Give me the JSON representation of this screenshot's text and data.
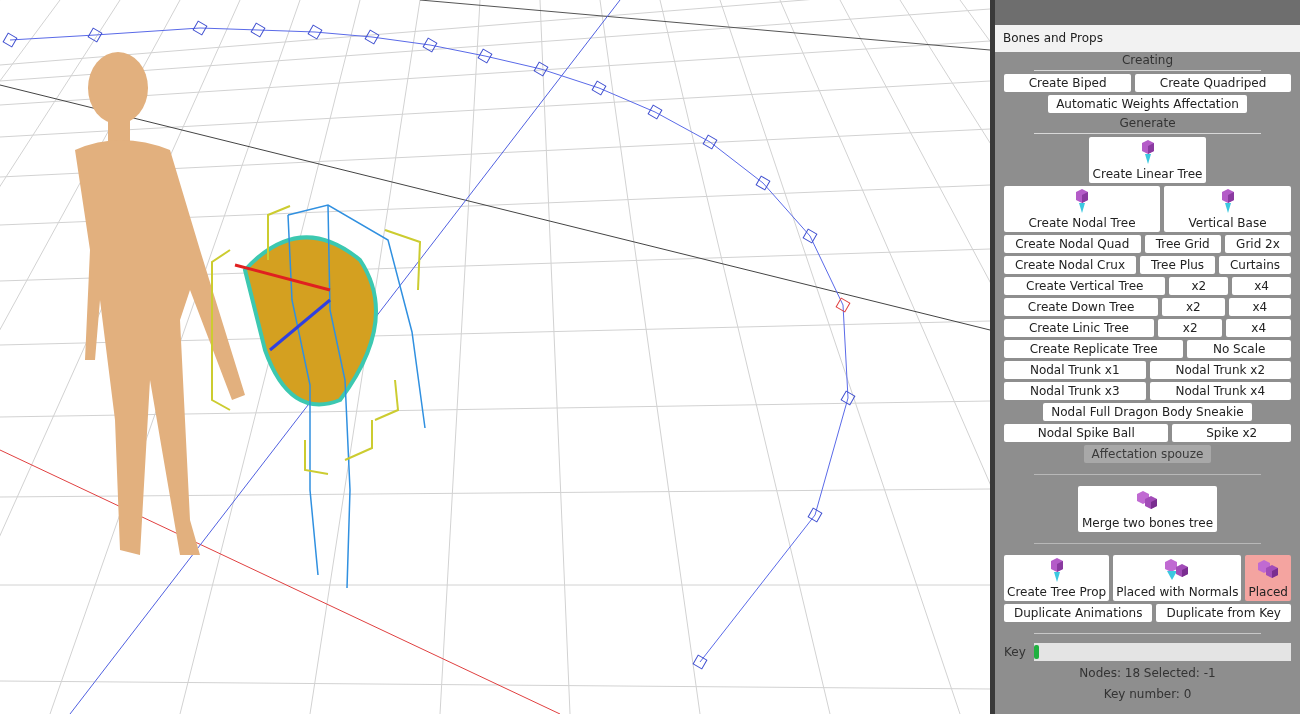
{
  "panel": {
    "title": "Bones and Props",
    "sections": [
      {
        "heading": "Creating",
        "rows": [
          [
            {
              "label": "Create Biped",
              "kind": "plain",
              "disabled": false
            },
            {
              "label": "Create Quadriped",
              "kind": "plain",
              "disabled": false
            }
          ],
          [
            {
              "label": "Automatic Weights Affectation",
              "kind": "plain",
              "disabled": false
            }
          ]
        ]
      },
      {
        "heading": "Generate",
        "rows": [
          [
            {
              "label": "Create Linear Tree",
              "kind": "tree",
              "disabled": false
            }
          ],
          [
            {
              "label": "Create Nodal Tree",
              "kind": "tree",
              "disabled": false
            },
            {
              "label": "Vertical Base",
              "kind": "tree",
              "disabled": false
            }
          ],
          [
            {
              "label": "Create Nodal Quad",
              "kind": "plain",
              "disabled": false
            },
            {
              "label": "Tree Grid",
              "kind": "plain",
              "disabled": false
            },
            {
              "label": "Grid 2x",
              "kind": "plain",
              "disabled": false
            }
          ],
          [
            {
              "label": "Create Nodal Crux",
              "kind": "plain",
              "disabled": false
            },
            {
              "label": "Tree Plus",
              "kind": "plain",
              "disabled": false
            },
            {
              "label": "Curtains",
              "kind": "plain",
              "disabled": false
            }
          ],
          [
            {
              "label": "Create Vertical Tree",
              "kind": "plain",
              "disabled": false
            },
            {
              "label": "x2",
              "kind": "plain",
              "disabled": false
            },
            {
              "label": "x4",
              "kind": "plain",
              "disabled": false
            }
          ],
          [
            {
              "label": "Create Down Tree",
              "kind": "plain",
              "disabled": false
            },
            {
              "label": "x2",
              "kind": "plain",
              "disabled": false
            },
            {
              "label": "x4",
              "kind": "plain",
              "disabled": false
            }
          ],
          [
            {
              "label": "Create Linic Tree",
              "kind": "plain",
              "disabled": false
            },
            {
              "label": "x2",
              "kind": "plain",
              "disabled": false
            },
            {
              "label": "x4",
              "kind": "plain",
              "disabled": false
            }
          ],
          [
            {
              "label": "Create Replicate Tree",
              "kind": "plain",
              "disabled": false
            },
            {
              "label": "No Scale",
              "kind": "plain",
              "disabled": false
            }
          ],
          [
            {
              "label": "Nodal Trunk x1",
              "kind": "plain",
              "disabled": false
            },
            {
              "label": "Nodal Trunk x2",
              "kind": "plain",
              "disabled": false
            }
          ],
          [
            {
              "label": "Nodal Trunk x3",
              "kind": "plain",
              "disabled": false
            },
            {
              "label": "Nodal Trunk x4",
              "kind": "plain",
              "disabled": false
            }
          ],
          [
            {
              "label": "Nodal Full Dragon Body Sneakie",
              "kind": "plain",
              "disabled": false
            }
          ],
          [
            {
              "label": "Nodal Spike Ball",
              "kind": "plain",
              "disabled": false
            },
            {
              "label": "Spike x2",
              "kind": "plain",
              "disabled": false
            }
          ],
          [
            {
              "label": "Affectation spouze",
              "kind": "plain",
              "disabled": true
            }
          ]
        ]
      },
      {
        "rows": [
          [
            {
              "label": "Merge two bones tree",
              "kind": "merge",
              "disabled": false
            }
          ]
        ]
      },
      {
        "rows": [
          [
            {
              "label": "Create Tree Prop",
              "kind": "tree",
              "disabled": false,
              "on": false
            },
            {
              "label": "Placed with Normals",
              "kind": "normals",
              "disabled": false,
              "on": false
            },
            {
              "label": "Placed",
              "kind": "merge",
              "disabled": false,
              "on": true
            }
          ],
          [
            {
              "label": "Duplicate Animations",
              "kind": "plain",
              "disabled": false
            },
            {
              "label": "Duplicate from Key",
              "kind": "plain",
              "disabled": false
            }
          ]
        ]
      }
    ],
    "key": {
      "label": "Key",
      "level": 0
    },
    "status": "Nodes: 18 Selected: -1",
    "key_number": "Key number: 0"
  }
}
